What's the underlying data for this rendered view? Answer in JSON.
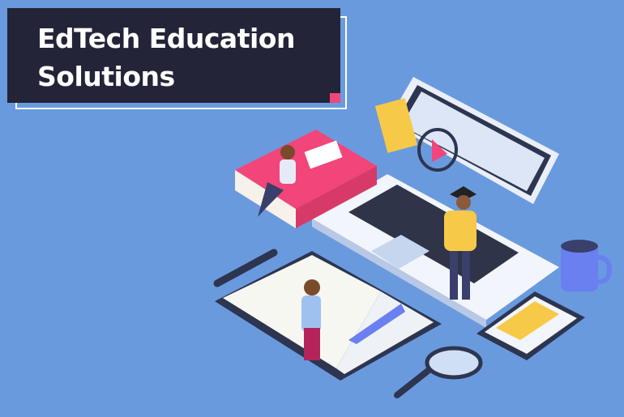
{
  "header": {
    "title_line1": "EdTech Education",
    "title_line2": "Solutions"
  },
  "colors": {
    "background": "#6a9ade",
    "title_box": "#232438",
    "accent": "#f2457a"
  },
  "illustration": {
    "icons": [
      "laptop-icon",
      "video-play-icon",
      "book-icon",
      "open-book-icon",
      "smartphone-icon",
      "mug-icon",
      "magnifier-icon",
      "pencil-icon",
      "graduate-person-icon",
      "student-person-icon"
    ]
  }
}
